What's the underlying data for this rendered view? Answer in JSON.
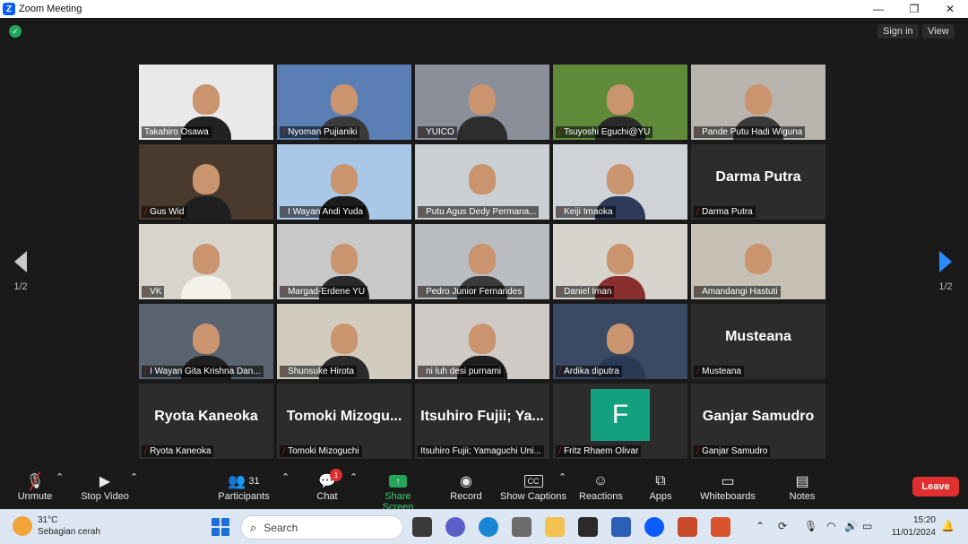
{
  "window": {
    "title": "Zoom Meeting",
    "logo": "Z"
  },
  "header": {
    "sign_in": "Sign in",
    "view": "View"
  },
  "pager": {
    "left": "1/2",
    "right": "1/2"
  },
  "tiles": [
    {
      "name": "Takahiro Osawa",
      "type": "video",
      "active": true,
      "muted": false,
      "bg": "#e9e9e9",
      "shirt": "#222222"
    },
    {
      "name": "Nyoman Pujianiki",
      "type": "video",
      "muted": true,
      "bg": "#5b7fb5",
      "shirt": "#3b3b3b"
    },
    {
      "name": "YUICO",
      "type": "video",
      "muted": true,
      "bg": "#8a8f99",
      "shirt": "#2d2d2d"
    },
    {
      "name": "Tsuyoshi Eguchi@YU",
      "type": "video",
      "muted": true,
      "bg": "#5f8a3a",
      "shirt": "#2a2a2a"
    },
    {
      "name": "Pande Putu Hadi Wiguna",
      "type": "video",
      "muted": true,
      "bg": "#b8b4ad",
      "shirt": "#3a3a3a"
    },
    {
      "name": "Gus Wid",
      "type": "video",
      "muted": true,
      "bg": "#4a3a2e",
      "shirt": "#1f1f1f"
    },
    {
      "name": "I Wayan Andi Yuda",
      "type": "video",
      "muted": true,
      "bg": "#a9c8e8",
      "shirt": "#1c1c1c"
    },
    {
      "name": "Putu Agus Dedy Permana...",
      "type": "video",
      "muted": true,
      "bg": "#c9cfd2",
      "shirt": "#c9cfd2"
    },
    {
      "name": "Keiji Imaoka",
      "type": "video",
      "muted": true,
      "bg": "#cfd3d8",
      "shirt": "#2f3a5a"
    },
    {
      "name": "Darma Putra",
      "type": "name",
      "muted": true
    },
    {
      "name": "VK",
      "type": "video",
      "muted": true,
      "bg": "#d8d4cc",
      "shirt": "#f4f1ea"
    },
    {
      "name": "Margad-Erdene YU",
      "type": "video",
      "muted": true,
      "bg": "#c8c8c8",
      "shirt": "#2a2a2a"
    },
    {
      "name": "Pedro Junior Fernandes",
      "type": "video",
      "muted": true,
      "bg": "#b9bcc0",
      "shirt": "#3a3a3a"
    },
    {
      "name": "Daniel Iman",
      "type": "video",
      "muted": true,
      "bg": "#d6d2cc",
      "shirt": "#8a2f2f"
    },
    {
      "name": "Amandangi Hastuti",
      "type": "video",
      "muted": true,
      "bg": "#c6c0b4",
      "shirt": "#c6c0b4"
    },
    {
      "name": "I Wayan Gita Krishna Dan...",
      "type": "video",
      "muted": true,
      "bg": "#5a6470",
      "shirt": "#1f1f1f"
    },
    {
      "name": "Shunsuke Hirota",
      "type": "video",
      "muted": true,
      "bg": "#d2ccbe",
      "shirt": "#2a2a2a"
    },
    {
      "name": "ni luh desi purnami",
      "type": "video",
      "muted": true,
      "bg": "#cfcac6",
      "shirt": "#1f1f1f"
    },
    {
      "name": "Ardika diputra",
      "type": "video",
      "muted": true,
      "bg": "#3a4a62",
      "shirt": "#2a3a55"
    },
    {
      "name": "Musteana",
      "type": "name",
      "muted": true
    },
    {
      "name": "Ryota Kaneoka",
      "type": "name",
      "muted": true
    },
    {
      "name": "Tomoki Mizoguchi",
      "type": "name",
      "big": "Tomoki  Mizogu...",
      "muted": true
    },
    {
      "name": "Itsuhiro Fujii; Yamaguchi Uni...",
      "type": "name",
      "big": "Itsuhiro Fujii; Ya...",
      "muted": false
    },
    {
      "name": "Fritz Rhaem Olivar",
      "type": "avatar",
      "initial": "F",
      "muted": true
    },
    {
      "name": "Ganjar Samudro",
      "type": "name",
      "muted": true
    }
  ],
  "toolbar": {
    "unmute": "Unmute",
    "stop_video": "Stop Video",
    "participants": "Participants",
    "participants_count": "31",
    "chat": "Chat",
    "chat_badge": "1",
    "share_screen": "Share Screen",
    "record": "Record",
    "show_captions": "Show Captions",
    "reactions": "Reactions",
    "apps": "Apps",
    "whiteboards": "Whiteboards",
    "notes": "Notes",
    "leave": "Leave"
  },
  "taskbar": {
    "temperature": "31°C",
    "weather": "Sebagian cerah",
    "search_placeholder": "Search",
    "time": "15:20",
    "date": "11/01/2024"
  },
  "colors": {
    "accent": "#0b5cff",
    "leave": "#e02f2f",
    "share": "#23a55a",
    "active_border": "#d8d84a"
  }
}
